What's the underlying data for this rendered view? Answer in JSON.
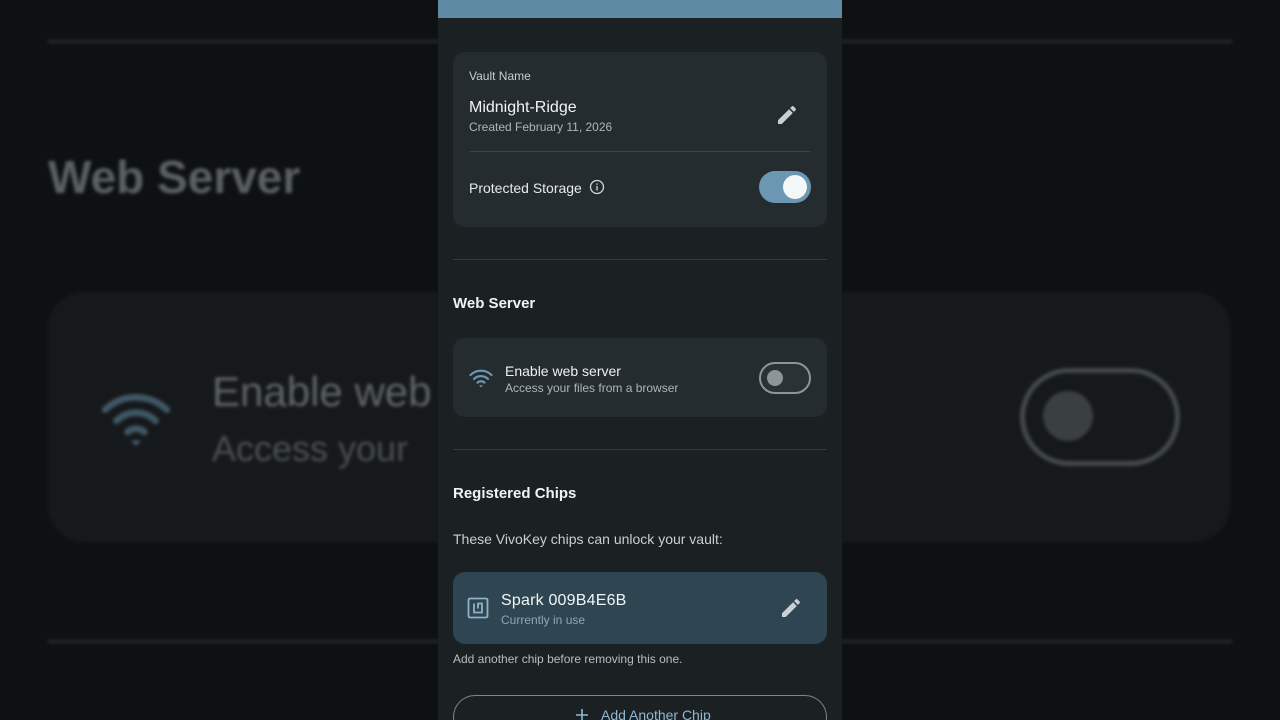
{
  "background": {
    "title": "Web Server",
    "enable_text": "Enable web",
    "access_text": "Access your"
  },
  "vault": {
    "label": "Vault Name",
    "name": "Midnight-Ridge",
    "created": "Created February 11, 2026",
    "protected_label": "Protected Storage",
    "protected_enabled": true
  },
  "web_server": {
    "section_title": "Web Server",
    "title": "Enable web server",
    "subtitle": "Access your files from a browser",
    "enabled": false
  },
  "chips": {
    "section_title": "Registered Chips",
    "description": "These VivoKey chips can unlock your vault:",
    "items": [
      {
        "name": "Spark 009B4E6B",
        "status": "Currently in use"
      }
    ],
    "hint": "Add another chip before removing this one.",
    "add_label": "Add Another Chip"
  },
  "colors": {
    "accent": "#6b97b3",
    "appbar": "#5e8aa4",
    "surface": "#252c2f",
    "chip_selected": "#2f4652"
  },
  "icons": {
    "edit": "pencil-icon",
    "info": "info-icon",
    "wifi": "wifi-icon",
    "chip": "nfc-chip-icon",
    "add": "plus-icon"
  }
}
